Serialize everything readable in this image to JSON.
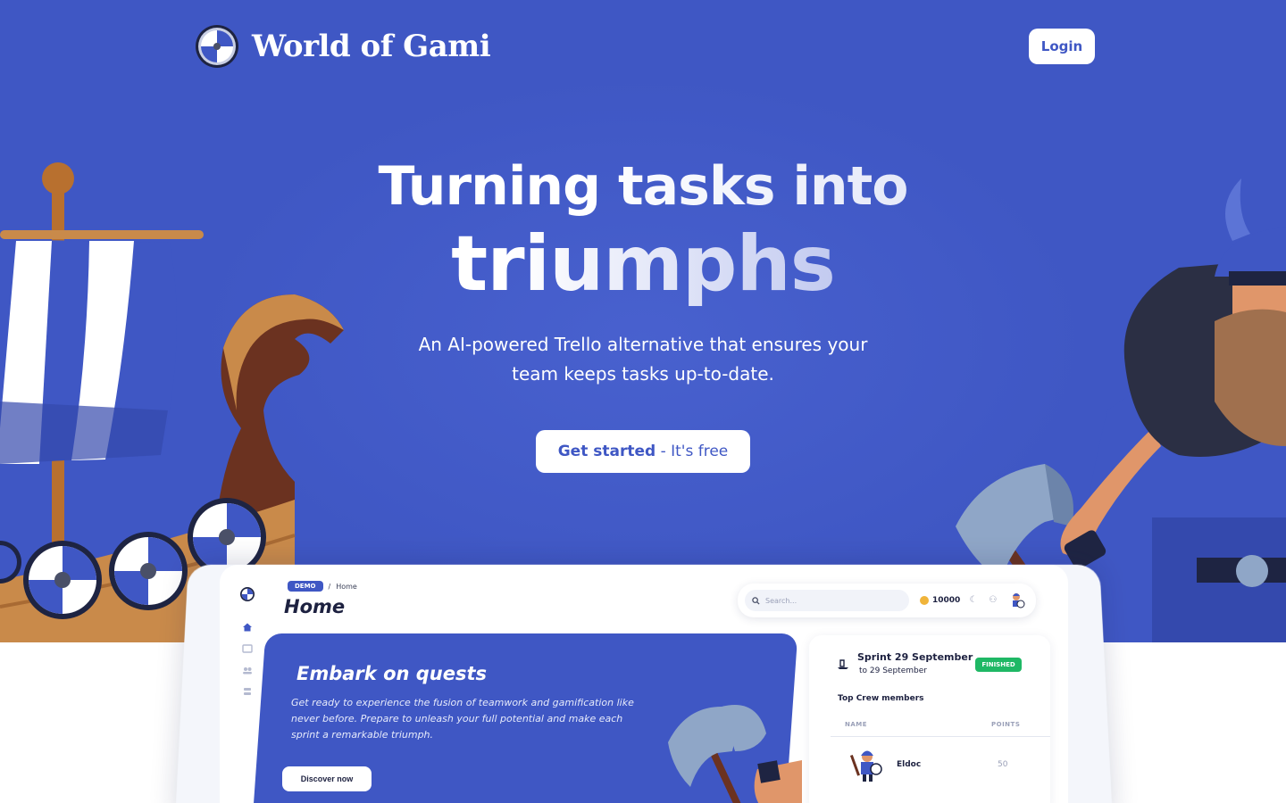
{
  "brand": {
    "name": "World of Gami",
    "logo_icon": "shield-icon"
  },
  "nav": {
    "login_label": "Login"
  },
  "hero": {
    "headline_line1": "Turning tasks into",
    "headline_line2": "triumphs",
    "subtitle": "An AI-powered Trello alternative that ensures your team keeps tasks up-to-date.",
    "cta_bold": "Get started",
    "cta_rest": " - It's free"
  },
  "preview": {
    "breadcrumb_badge": "DEMO",
    "breadcrumb_separator": "/",
    "breadcrumb_page": "Home",
    "page_title": "Home",
    "search_placeholder": "Search...",
    "coins": "10000",
    "quest": {
      "title": "Embark on quests",
      "text": "Get ready to experience the fusion of teamwork and gamification like never before. Prepare to unleash your full potential and make each sprint a remarkable triumph.",
      "button": "Discover now"
    },
    "sprint": {
      "title": "Sprint 29 September",
      "date": "to 29 September",
      "status": "FINISHED",
      "crew_title": "Top Crew members",
      "col_name": "NAME",
      "col_points": "POINTS",
      "rows": [
        {
          "name": "Eldoc",
          "points": "50"
        }
      ]
    }
  },
  "colors": {
    "brand_blue": "#3f57c4",
    "success_green": "#1fb865",
    "coin_gold": "#f0b43a"
  }
}
